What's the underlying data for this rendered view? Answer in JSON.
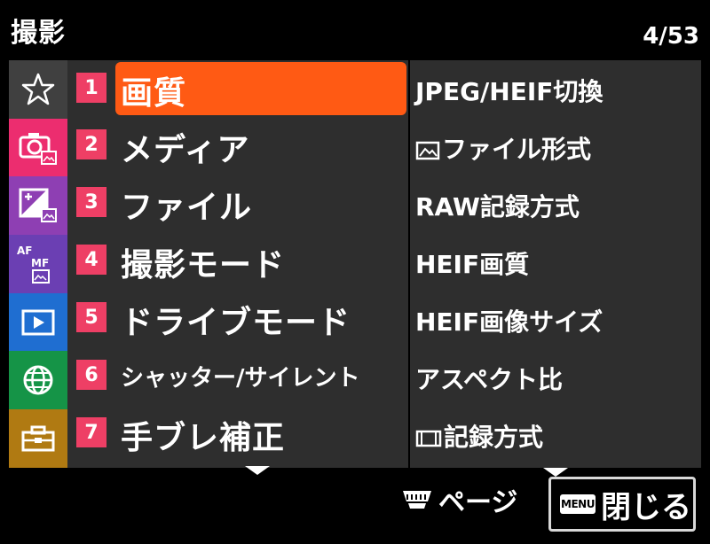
{
  "header": {
    "title": "撮影",
    "page_indicator": "4/53"
  },
  "categories": [
    {
      "name": "star-icon",
      "color": "#404040"
    },
    {
      "name": "camera-icon",
      "color": "#ec2d6f"
    },
    {
      "name": "exposure-icon",
      "color": "#8e3fb3"
    },
    {
      "name": "af-mf-icon",
      "color": "#6b3fb3",
      "text_af": "AF",
      "text_mf": "MF"
    },
    {
      "name": "playback-icon",
      "color": "#1f6ed1"
    },
    {
      "name": "globe-icon",
      "color": "#159447"
    },
    {
      "name": "toolbox-icon",
      "color": "#b07a12"
    }
  ],
  "menu_items": [
    {
      "number": "1",
      "label": "画質",
      "selected": true
    },
    {
      "number": "2",
      "label": "メディア",
      "selected": false
    },
    {
      "number": "3",
      "label": "ファイル",
      "selected": false
    },
    {
      "number": "4",
      "label": "撮影モード",
      "selected": false
    },
    {
      "number": "5",
      "label": "ドライブモード",
      "selected": false
    },
    {
      "number": "6",
      "label": "シャッター/サイレント",
      "selected": false
    },
    {
      "number": "7",
      "label": "手ブレ補正",
      "selected": false
    }
  ],
  "sub_items": [
    {
      "label": "JPEG/HEIF切換",
      "icon": ""
    },
    {
      "label": "ファイル形式",
      "icon": "still-image-icon"
    },
    {
      "label": "RAW記録方式",
      "icon": ""
    },
    {
      "label": "HEIF画質",
      "icon": ""
    },
    {
      "label": "HEIF画像サイズ",
      "icon": ""
    },
    {
      "label": "アスペクト比",
      "icon": ""
    },
    {
      "label": "記録方式",
      "icon": "aspect-frame-icon"
    }
  ],
  "footer": {
    "page_label": "ページ",
    "page_icon": "dial-icon",
    "menu_badge": "MENU",
    "close_label": "閉じる"
  },
  "colors": {
    "accent_selected": "#ff5a14",
    "number_badge": "#ee3f65",
    "panel_bg": "#2e2e2e"
  }
}
